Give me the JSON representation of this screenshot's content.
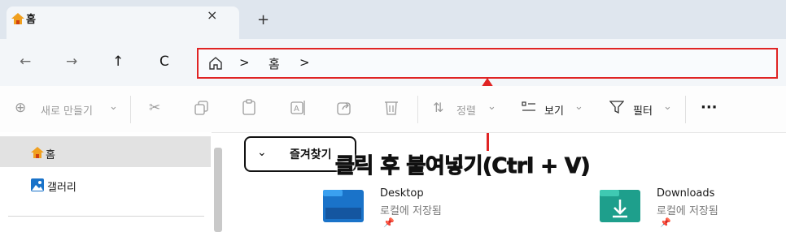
{
  "tab": {
    "title": "홈",
    "close": "×",
    "new_tab": "+"
  },
  "nav": {
    "back": "←",
    "forward": "→",
    "up": "↑",
    "refresh": "C"
  },
  "address": {
    "home_icon": "home-icon",
    "sep1": ">",
    "crumb": "홈",
    "sep2": ">"
  },
  "toolbar": {
    "new_label": "새로 만들기",
    "new_caret": "⌄",
    "sort_label": "정렬",
    "view_label": "보기",
    "filter_label": "필터",
    "more": "···"
  },
  "sidebar": {
    "items": [
      {
        "label": "홈"
      },
      {
        "label": "갤러리"
      }
    ]
  },
  "main": {
    "section_label": "즐겨찾기",
    "section_chevron": "⌄",
    "files": [
      {
        "name": "Desktop",
        "sub": "로컬에 저장됨",
        "pin": "📌"
      },
      {
        "name": "Downloads",
        "sub": "로컬에 저장됨",
        "pin": "📌"
      }
    ]
  },
  "annotation": {
    "text": "클릭 후 붙여넣기(Ctrl + V)"
  },
  "colors": {
    "accent_red": "#e02424",
    "folder_blue": "#1a73c9",
    "folder_teal": "#1e9f8c"
  }
}
